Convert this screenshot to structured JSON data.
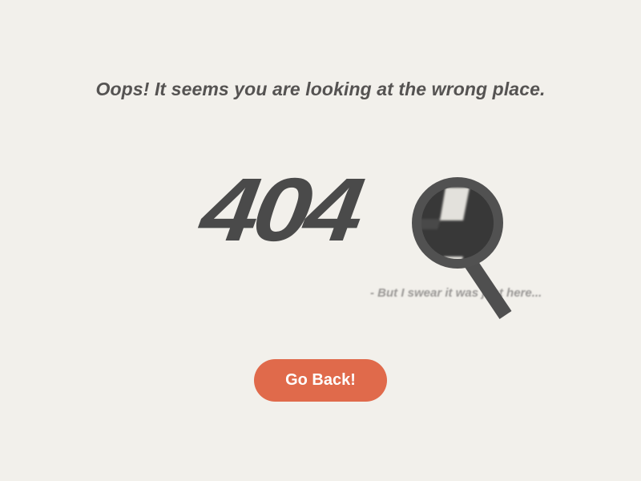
{
  "page": {
    "headline": "Oops! It seems you are looking at the wrong place.",
    "error_code": "404",
    "subline": "- But I swear it was just here...",
    "button_label": "Go Back!"
  },
  "icons": {
    "magnifier": "magnifying-glass-icon"
  },
  "colors": {
    "background": "#f2f0eb",
    "text": "#555352",
    "glyph": "#4a4a4a",
    "button": "#e06a4b",
    "button_text": "#ffffff"
  }
}
